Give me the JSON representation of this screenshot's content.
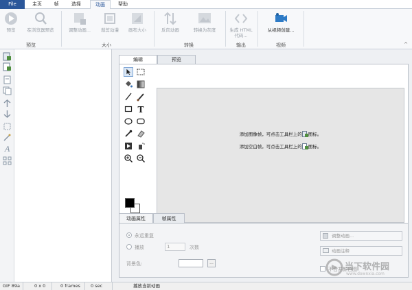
{
  "ribbon_tabs": [
    "File",
    "主页",
    "帧",
    "选择",
    "动画",
    "帮助"
  ],
  "ribbon": {
    "preview_btn": "预览",
    "browser_preview_btn": "在浏览器预览",
    "adjust_anim_btn": "调整动画...",
    "crop_btn": "裁剪动漫",
    "resize_btn": "画布大小",
    "reverse_btn": "反向动画",
    "grayscale_btn": "转换为灰度",
    "html_btn_line1": "生成 HTML",
    "html_btn_line2": "代码...",
    "from_video_btn": "从视频创建...",
    "group_preview": "预览",
    "group_size": "大小",
    "group_convert": "转换",
    "group_output": "输出",
    "group_video": "视频",
    "collapse_glyph": "^"
  },
  "workspace": {
    "tab_edit": "编辑",
    "tab_preview": "预览",
    "hint_image": "添加图像帧，可点击工具栏上的",
    "hint_blank": "添加空白帧，可点击工具栏上的",
    "hint_suffix": "图标。",
    "colors": {
      "foreground": "#000000",
      "background": "#ffffff"
    }
  },
  "properties": {
    "tab_anim": "动画属性",
    "tab_frame": "帧属性",
    "loop_forever": "永远重复",
    "play": "播放",
    "play_count": "1",
    "times": "次数",
    "bg_color": "背景色:",
    "dots": "...",
    "adjust_anim": "调整动画...",
    "anim_comment": "动画注释",
    "merge_colors": "不合并颜色图"
  },
  "status": {
    "format": "GIF 89a",
    "size": "0 x 0",
    "frames": "0 frames",
    "time": "0 sec",
    "message": "播放当前动画"
  },
  "watermark": {
    "text": "当下软件园",
    "url": "www.downxia.com"
  },
  "accent": "#2b579a"
}
